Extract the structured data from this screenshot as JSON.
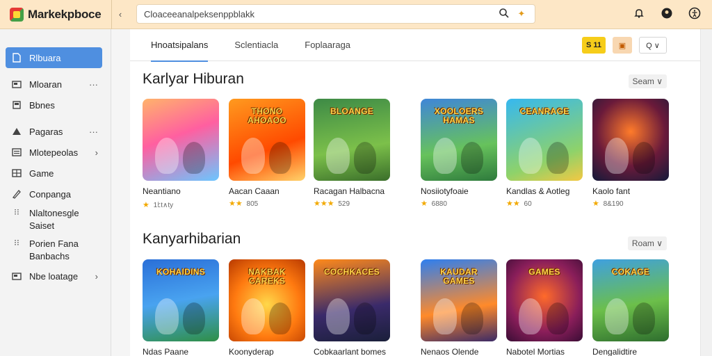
{
  "app": {
    "title": "Markekpboce"
  },
  "search": {
    "value": "Cloaceeanalpeksenppblakk"
  },
  "sidebar": {
    "items": [
      {
        "label": "Rlbuara",
        "icon": "document-icon"
      },
      {
        "label": "Mloaran",
        "icon": "folder-icon",
        "extra": "···"
      },
      {
        "label": "Bbnes",
        "icon": "book-icon"
      },
      {
        "label": "Pagaras",
        "icon": "triangle-icon",
        "extra": "···"
      },
      {
        "label": "Mlotepeolas",
        "icon": "list-icon",
        "extra": "›"
      },
      {
        "label": "Game",
        "icon": "grid-icon"
      },
      {
        "label": "Conpanga",
        "icon": "pen-icon"
      },
      {
        "label": "Nlaltonesgle",
        "sublabel": "Saiset",
        "icon": "dots-icon"
      },
      {
        "label": "Porien Fana",
        "sublabel": "Banbachs",
        "icon": "dots-icon"
      },
      {
        "label": "Nbe loatage",
        "icon": "folder-icon",
        "extra": "›"
      }
    ]
  },
  "tabs": [
    {
      "label": "Hnoatsipalans"
    },
    {
      "label": "Sclentiacla"
    },
    {
      "label": "Foplaaraga"
    }
  ],
  "tab_buttons": {
    "yellow": "S 11",
    "orange": "▣",
    "dropdown": "Q ∨"
  },
  "sections": [
    {
      "title": "Karlyar Hiburan",
      "see_all": "Seam ∨",
      "cards": [
        {
          "name": "Neantiano",
          "rating": "★ 1ﾋt∧ty",
          "thumb_title": "",
          "bg": "linear-gradient(160deg,#ffb36b,#ff5fa0 45%,#6bc6ff)"
        },
        {
          "name": "Aacan Caaan",
          "rating": "★★ 805",
          "thumb_title": "THONO AHOAOO",
          "bg": "linear-gradient(160deg,#ff9a1f,#ff4a00 60%,#ffd36b)"
        },
        {
          "name": "Racagan Halbacna",
          "rating": "★★★ 529",
          "thumb_title": "BLOANGE",
          "bg": "linear-gradient(170deg,#3d8a46,#7cc04a 60%,#3a6e2a)"
        },
        {
          "name": "Nosiiotyfoaie",
          "rating": "★ 6880",
          "thumb_title": "XOOLOERS HAMAS",
          "bg": "linear-gradient(170deg,#3f86d8,#67c25c 60%,#2e7a3c)"
        },
        {
          "name": "Kandlas & Aotleg",
          "rating": "★★ 60",
          "thumb_title": "CEANRAGE",
          "bg": "linear-gradient(160deg,#36b8f0,#8ed26a 70%,#f3c843)"
        },
        {
          "name": "Kaolo fant",
          "rating": "★ 8&190",
          "thumb_title": "",
          "bg": "radial-gradient(circle at 50% 40%,#ff7b2a,#6a1a3a 55%,#141a3a)"
        }
      ]
    },
    {
      "title": "Kanyarhibarian",
      "see_all": "Roam ∨",
      "cards": [
        {
          "name": "Ndas Paane",
          "rating": "",
          "thumb_title": "KOHAIDINS",
          "bg": "linear-gradient(170deg,#2a6fd8,#49a3f0 50%,#2f8f46)"
        },
        {
          "name": "Koonyderap",
          "rating": "",
          "thumb_title": "NAKBAK CAREKS",
          "bg": "radial-gradient(circle at 50% 55%,#ffd84a,#ff7a10 55%,#b83a00)"
        },
        {
          "name": "Cobkaarlant bomes",
          "rating": "",
          "thumb_title": "COCHKACES",
          "bg": "linear-gradient(170deg,#ff8a1a,#3a2a6a 60%,#1a1f3a)"
        },
        {
          "name": "Nenaos Olende",
          "rating": "",
          "thumb_title": "KAUDAR GAMES",
          "bg": "linear-gradient(170deg,#2e7ff0,#ff8a2a 60%,#3b2a66)"
        },
        {
          "name": "Nabotel Mortias",
          "rating": "",
          "thumb_title": "GAMES",
          "bg": "radial-gradient(circle at 50% 45%,#ff6a2a,#8a1e5a 60%,#3a0d35)"
        },
        {
          "name": "Dengalidtire",
          "rating": "",
          "thumb_title": "COKAGE",
          "bg": "linear-gradient(170deg,#3fa0e0,#6cbf4a 55%,#2e6e2e)"
        }
      ]
    }
  ],
  "colors": {
    "accent": "#4f8fe0",
    "topbar": "#fde7c6",
    "star": "#f2a900"
  }
}
